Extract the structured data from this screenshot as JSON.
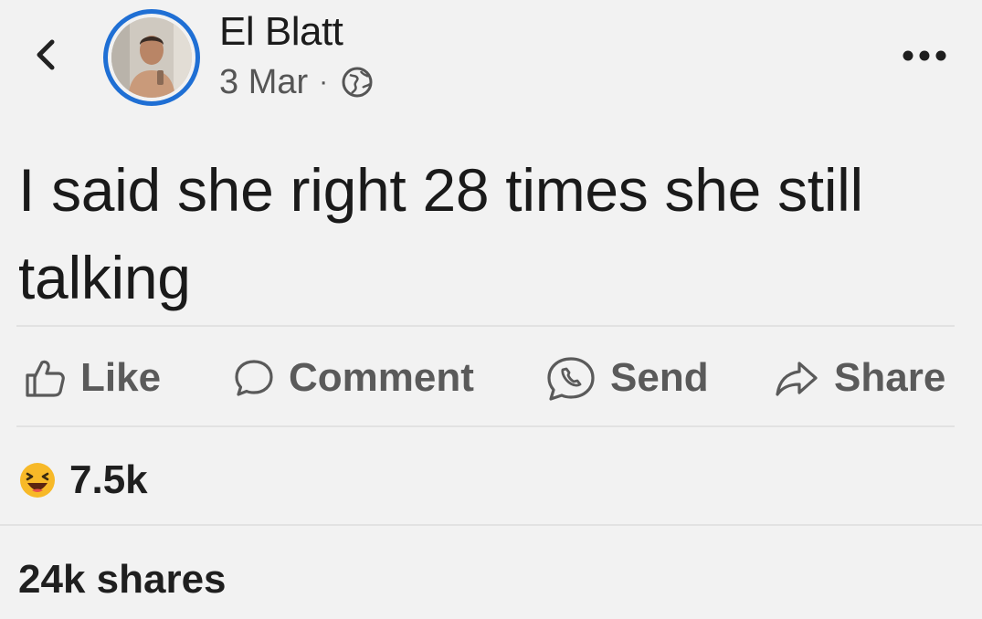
{
  "header": {
    "author_name": "El Blatt",
    "date": "3 Mar",
    "separator": "·",
    "icons": {
      "back": "chevron-left-icon",
      "privacy": "globe-icon",
      "more": "more-horizontal-icon"
    }
  },
  "post": {
    "text": "I said she right 28 times she still talking"
  },
  "actions": {
    "like_label": "Like",
    "comment_label": "Comment",
    "send_label": "Send",
    "share_label": "Share"
  },
  "reactions": {
    "type": "haha",
    "count": "7.5k"
  },
  "shares": {
    "label": "24k shares"
  },
  "colors": {
    "background": "#f2f2f2",
    "avatar_ring": "#1f6fd4",
    "action_gray": "#5a5a5a",
    "reaction_yellow": "#f7b928"
  }
}
